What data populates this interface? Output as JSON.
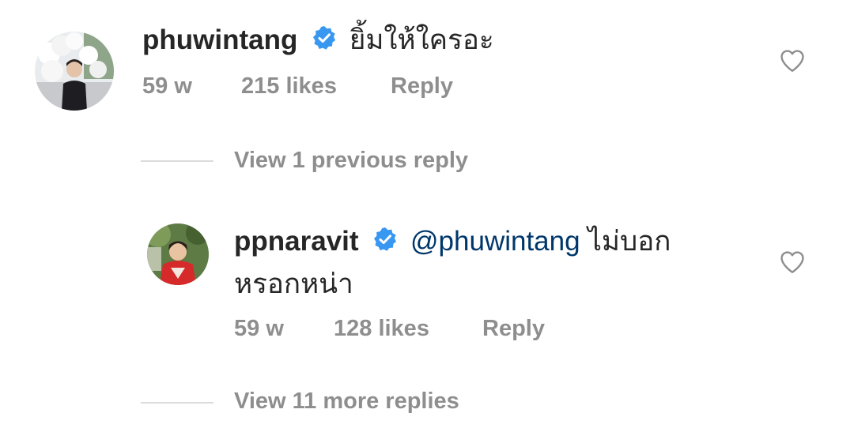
{
  "comment": {
    "username": "phuwintang",
    "text": "ยิ้มให้ใครอะ",
    "time": "59 w",
    "likes": "215 likes",
    "reply_label": "Reply"
  },
  "previous_replies_label": "View 1 previous reply",
  "reply": {
    "username": "ppnaravit",
    "mention": "@phuwintang",
    "text_line1": " ไม่บอก",
    "text_line2": "หรอกหน่า",
    "time": "59 w",
    "likes": "128 likes",
    "reply_label": "Reply"
  },
  "more_replies_label": "View 11 more replies",
  "colors": {
    "verified_badge": "#3897f0",
    "mention": "#00376b",
    "meta_text": "#8e8e8e"
  },
  "icons": {
    "verified": "verified-badge-icon",
    "like": "heart-outline-icon"
  }
}
